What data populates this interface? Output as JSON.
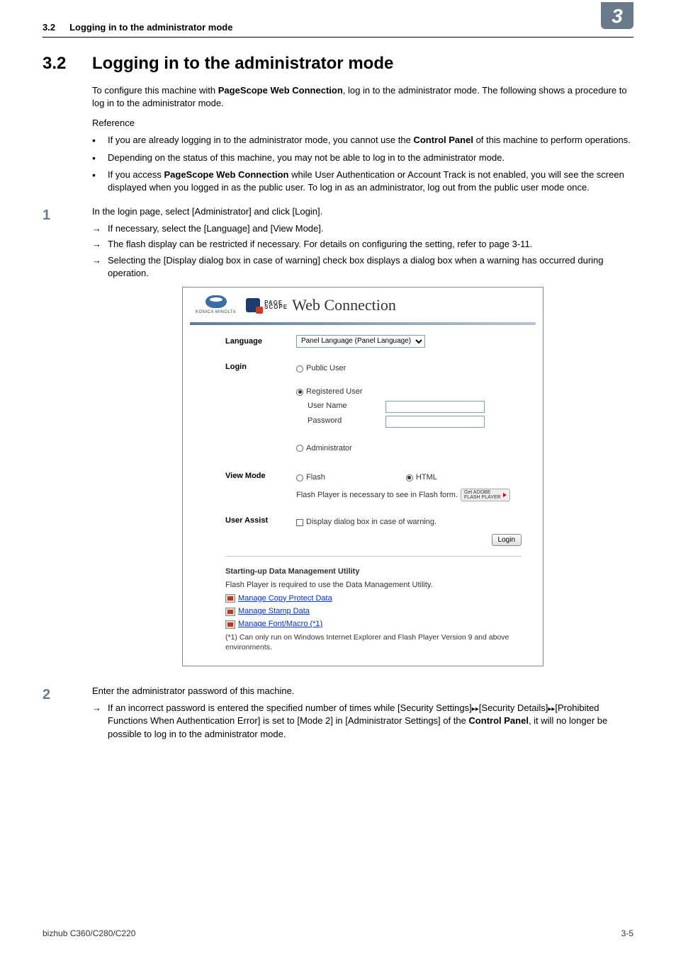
{
  "header": {
    "section_num": "3.2",
    "section_title": "Logging in to the administrator mode",
    "badge": "3"
  },
  "heading": {
    "num": "3.2",
    "title": "Logging in to the administrator mode"
  },
  "intro": {
    "pre": "To configure this machine with ",
    "bold": "PageScope Web Connection",
    "post": ", log in to the administrator mode. The following shows a procedure to log in to the administrator mode."
  },
  "reference_label": "Reference",
  "bullets": [
    {
      "pre": "If you are already logging in to the administrator mode, you cannot use the ",
      "bold": "Control Panel",
      "post": " of this machine to perform operations."
    },
    {
      "pre": "Depending on the status of this machine, you may not be able to log in to the administrator mode.",
      "bold": "",
      "post": ""
    },
    {
      "pre": "If you access ",
      "bold": "PageScope Web Connection",
      "post": " while User Authentication or Account Track is not enabled, you will see the screen displayed when you logged in as the public user. To log in as an administrator, log out from the public user mode once."
    }
  ],
  "steps": [
    {
      "num": "1",
      "text": "In the login page, select [Administrator] and click [Login].",
      "subs": [
        "If necessary, select the [Language] and [View Mode].",
        "The flash display can be restricted if necessary. For details on configuring the setting, refer to page 3-11.",
        "Selecting the [Display dialog box in case of warning] check box displays a dialog box when a warning has occurred during operation."
      ]
    },
    {
      "num": "2",
      "text": "Enter the administrator password of this machine.",
      "subs_rich": {
        "pre": "If an incorrect password is entered the specified number of times while [Security Settings]",
        "arrow1": "▸▸",
        "mid1": "[Security Details]",
        "arrow2": "▸▸",
        "mid2": "[Prohibited Functions When Authentication Error] is set to [Mode 2] in [Administrator Settings] of the ",
        "bold": "Control Panel",
        "post": ", it will no longer be possible to log in to the administrator mode."
      }
    }
  ],
  "screenshot": {
    "km_brand": "KONICA MINOLTA",
    "ps_small": "PAGE\nSCOPE",
    "ps_big": "Web Connection",
    "language_label": "Language",
    "language_value": "Panel Language (Panel Language)",
    "login_label": "Login",
    "public_user": "Public User",
    "registered_user": "Registered User",
    "user_name": "User Name",
    "password": "Password",
    "administrator": "Administrator",
    "view_mode_label": "View Mode",
    "flash": "Flash",
    "html": "HTML",
    "flash_note": "Flash Player is necessary to see in Flash form.",
    "adobe_btn": "Get ADOBE\nFLASH PLAYER",
    "user_assist_label": "User Assist",
    "user_assist_text": "Display dialog box in case of warning.",
    "login_btn": "Login",
    "starting_title": "Starting-up Data Management Utility",
    "starting_note": "Flash Player is required to use the Data Management Utility.",
    "link1": "Manage Copy Protect Data",
    "link2": "Manage Stamp Data",
    "link3": "Manage Font/Macro (*1)",
    "star_note": "(*1) Can only run on Windows Internet Explorer and Flash Player Version 9 and above environments."
  },
  "footer": {
    "left": "bizhub C360/C280/C220",
    "right": "3-5"
  }
}
